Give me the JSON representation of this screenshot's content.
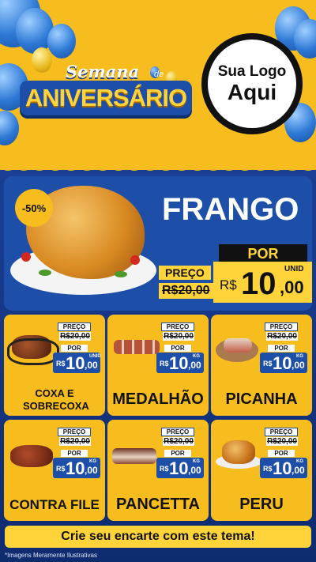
{
  "header": {
    "title_top": "Semana",
    "title_de": "de",
    "title_main": "ANIVERSÁRIO",
    "logo_line1": "Sua Logo",
    "logo_line2": "Aqui"
  },
  "hero": {
    "discount": "-50%",
    "name": "FRANGO",
    "preco_label": "PREÇO",
    "old_price": "R$20,00",
    "por_label": "POR",
    "currency": "R$",
    "price_int": "10",
    "price_dec": ",00",
    "unit": "UNID"
  },
  "products": [
    {
      "name": "COXA E SOBRECOXA",
      "preco_label": "PREÇO",
      "old_price": "R$20,00",
      "por_label": "POR",
      "currency": "R$",
      "price_int": "10",
      "price_dec": ",00",
      "unit": "UNID"
    },
    {
      "name": "MEDALHÃO",
      "preco_label": "PREÇO",
      "old_price": "R$20,00",
      "por_label": "POR",
      "currency": "R$",
      "price_int": "10",
      "price_dec": ",00",
      "unit": "KG"
    },
    {
      "name": "PICANHA",
      "preco_label": "PREÇO",
      "old_price": "R$20,00",
      "por_label": "POR",
      "currency": "R$",
      "price_int": "10",
      "price_dec": ",00",
      "unit": "KG"
    },
    {
      "name": "CONTRA FILE",
      "preco_label": "PREÇO",
      "old_price": "R$20,00",
      "por_label": "POR",
      "currency": "R$",
      "price_int": "10",
      "price_dec": ",00",
      "unit": "KG"
    },
    {
      "name": "PANCETTA",
      "preco_label": "PREÇO",
      "old_price": "R$20,00",
      "por_label": "POR",
      "currency": "R$",
      "price_int": "10",
      "price_dec": ",00",
      "unit": "KG"
    },
    {
      "name": "PERU",
      "preco_label": "PREÇO",
      "old_price": "R$20,00",
      "por_label": "POR",
      "currency": "R$",
      "price_int": "10",
      "price_dec": ",00",
      "unit": "KG"
    }
  ],
  "banner": "Crie seu encarte com este tema!",
  "footnote": "*Imagens Meramente Ilustrativas",
  "colors": {
    "yellow": "#f7bd1e",
    "blue": "#1d4ea8",
    "black": "#111111"
  }
}
